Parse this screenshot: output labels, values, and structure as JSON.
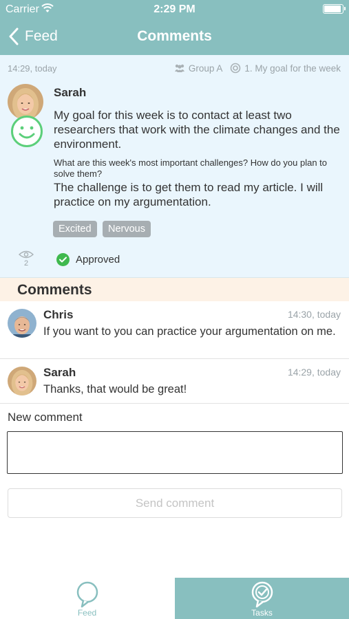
{
  "status_bar": {
    "carrier": "Carrier",
    "time": "2:29 PM"
  },
  "nav": {
    "back_label": "Feed",
    "title": "Comments"
  },
  "post": {
    "time": "14:29, today",
    "group": "Group A",
    "goal_ref": "1. My goal for the week",
    "author": "Sarah",
    "goal_text": "My goal for this week is to contact at least two researchers that work with the climate changes and the environment.",
    "question": "What are this week's most important challenges? How do you plan to solve them?",
    "answer": "The challenge is to get them to read my article. I will practice on my argumentation.",
    "tags": [
      "Excited",
      "Nervous"
    ],
    "views": "2",
    "status": "Approved"
  },
  "comments_section": {
    "title": "Comments"
  },
  "comments": [
    {
      "author": "Chris",
      "time": "14:30, today",
      "text": "If you want to you can practice your argumentation on me."
    },
    {
      "author": "Sarah",
      "time": "14:29, today",
      "text": "Thanks, that would be great!"
    }
  ],
  "new_comment": {
    "label": "New comment",
    "value": "",
    "send_label": "Send comment"
  },
  "tabbar": {
    "feed_label": "Feed",
    "tasks_label": "Tasks",
    "active": "Tasks"
  },
  "colors": {
    "teal": "#88bfbf",
    "post_bg": "#eaf6fd",
    "comments_header_bg": "#fdf2e6",
    "tag_bg": "#a7aeb2",
    "approved_green": "#3fb94e",
    "mood_green": "#5ccf7a"
  },
  "icons": [
    "wifi-icon",
    "battery-icon",
    "back-chevron-icon",
    "group-icon",
    "goal-icon",
    "smiley-icon",
    "eye-icon",
    "checkmark-icon",
    "feed-bubble-icon",
    "tasks-check-icon"
  ]
}
